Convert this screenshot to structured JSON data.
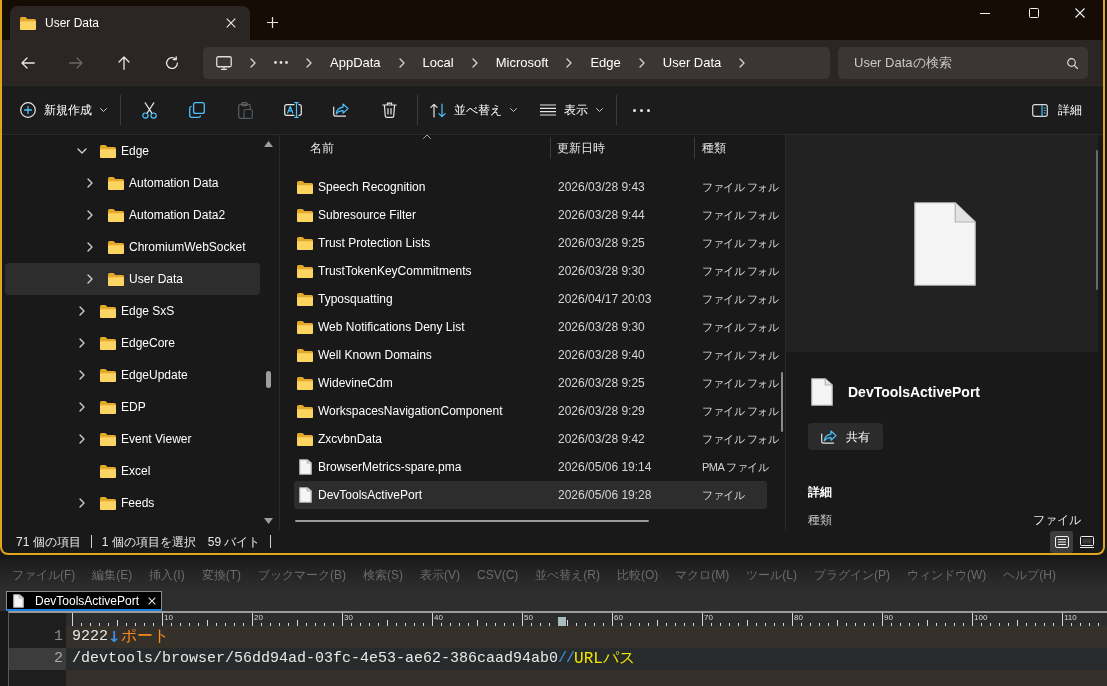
{
  "window": {
    "tabs": [
      {
        "title": "User Data",
        "selected": true
      }
    ]
  },
  "navigation": {
    "buttons": [
      {
        "kind": "back",
        "disabled": false
      },
      {
        "kind": "forward",
        "disabled": true
      },
      {
        "kind": "up",
        "disabled": false
      },
      {
        "kind": "refresh",
        "disabled": false
      }
    ],
    "breadcrumb": [
      "AppData",
      "Local",
      "Microsoft",
      "Edge",
      "User Data"
    ],
    "search": {
      "placeholder": "User Dataの検索"
    }
  },
  "toolbar": {
    "items": [
      {
        "kind": "new",
        "label": "新規作成",
        "disabled": false
      },
      {
        "kind": "separator"
      },
      {
        "kind": "cut",
        "disabled": false
      },
      {
        "kind": "copy",
        "disabled": false
      },
      {
        "kind": "paste",
        "disabled": true
      },
      {
        "kind": "rename",
        "disabled": false
      },
      {
        "kind": "share",
        "disabled": false
      },
      {
        "kind": "delete",
        "disabled": false
      },
      {
        "kind": "separator"
      },
      {
        "kind": "sort",
        "label": "並べ替え",
        "disabled": false
      },
      {
        "kind": "view",
        "label": "表示",
        "disabled": false
      },
      {
        "kind": "separator"
      },
      {
        "kind": "more",
        "disabled": false
      }
    ],
    "details_button": {
      "label": "詳細"
    }
  },
  "nav_tree": [
    {
      "label": "Edge",
      "expanded": true,
      "selected": false,
      "children": [
        {
          "label": "Automation Data",
          "expanded": false,
          "selected": false
        },
        {
          "label": "Automation Data2",
          "expanded": false,
          "selected": false
        },
        {
          "label": "ChromiumWebSocket",
          "expanded": false,
          "selected": false
        },
        {
          "label": "User Data",
          "expanded": false,
          "selected": true
        }
      ]
    },
    {
      "label": "Edge SxS",
      "expanded": false,
      "selected": false
    },
    {
      "label": "EdgeCore",
      "expanded": false,
      "selected": false
    },
    {
      "label": "EdgeUpdate",
      "expanded": false,
      "selected": false
    },
    {
      "label": "EDP",
      "expanded": false,
      "selected": false
    },
    {
      "label": "Event Viewer",
      "expanded": false,
      "selected": false
    },
    {
      "label": "Excel",
      "selected": false
    },
    {
      "label": "Feeds",
      "expanded": false,
      "selected": false
    }
  ],
  "file_list": {
    "columns": [
      {
        "label": "名前",
        "sorted": true
      },
      {
        "label": "更新日時",
        "sorted": false
      },
      {
        "label": "種類",
        "sorted": false
      }
    ],
    "rows": [
      {
        "kind": "folder",
        "name": "Speech Recognition",
        "modified": "2026/03/28 9:43",
        "type": "ファイル フォル",
        "selected": false
      },
      {
        "kind": "folder",
        "name": "Subresource Filter",
        "modified": "2026/03/28 9:44",
        "type": "ファイル フォル",
        "selected": false
      },
      {
        "kind": "folder",
        "name": "Trust Protection Lists",
        "modified": "2026/03/28 9:25",
        "type": "ファイル フォル",
        "selected": false
      },
      {
        "kind": "folder",
        "name": "TrustTokenKeyCommitments",
        "modified": "2026/03/28 9:30",
        "type": "ファイル フォル",
        "selected": false
      },
      {
        "kind": "folder",
        "name": "Typosquatting",
        "modified": "2026/04/17 20:03",
        "type": "ファイル フォル",
        "selected": false
      },
      {
        "kind": "folder",
        "name": "Web Notifications Deny List",
        "modified": "2026/03/28 9:30",
        "type": "ファイル フォル",
        "selected": false
      },
      {
        "kind": "folder",
        "name": "Well Known Domains",
        "modified": "2026/03/28 9:40",
        "type": "ファイル フォル",
        "selected": false
      },
      {
        "kind": "folder",
        "name": "WidevineCdm",
        "modified": "2026/03/28 9:25",
        "type": "ファイル フォル",
        "selected": false
      },
      {
        "kind": "folder",
        "name": "WorkspacesNavigationComponent",
        "modified": "2026/03/28 9:29",
        "type": "ファイル フォル",
        "selected": false
      },
      {
        "kind": "folder",
        "name": "ZxcvbnData",
        "modified": "2026/03/28 9:42",
        "type": "ファイル フォル",
        "selected": false
      },
      {
        "kind": "file",
        "name": "BrowserMetrics-spare.pma",
        "modified": "2026/05/06 19:14",
        "type": "PMA ファイル",
        "selected": false
      },
      {
        "kind": "file",
        "name": "DevToolsActivePort",
        "modified": "2026/05/06 19:28",
        "type": "ファイル",
        "selected": true
      }
    ]
  },
  "details_pane": {
    "title": "DevToolsActivePort",
    "share_label": "共有",
    "section_title": "詳細",
    "properties": [
      {
        "label": "種類",
        "value": "ファイル"
      }
    ]
  },
  "status_bar": {
    "item_count": "71 個の項目",
    "selection": "1 個の項目を選択",
    "size": "59 バイト",
    "views": [
      {
        "kind": "details",
        "selected": true
      },
      {
        "kind": "preview",
        "selected": false
      }
    ]
  },
  "editor": {
    "menu": [
      "ファイル(F)",
      "編集(E)",
      "挿入(I)",
      "変換(T)",
      "ブックマーク(B)",
      "検索(S)",
      "表示(V)",
      "CSV(C)",
      "並べ替え(R)",
      "比較(O)",
      "マクロ(M)",
      "ツール(L)",
      "プラグイン(P)",
      "ウィンドウ(W)",
      "ヘルプ(H)"
    ],
    "tabs": [
      {
        "title": "DevToolsActivePort",
        "selected": true
      }
    ],
    "ruler": {
      "labels": [
        "10",
        "20",
        "30",
        "40",
        "50",
        "60",
        "70",
        "80",
        "90",
        "100",
        "110"
      ]
    },
    "lines": [
      {
        "number": "1",
        "current": false,
        "segments": [
          {
            "kind": "code",
            "text": "9222",
            "color": "#e8e8e8"
          },
          {
            "kind": "newline-mark",
            "text": "↓",
            "color": "#3f8fe8"
          },
          {
            "kind": "comment",
            "text": "ポート",
            "color": "#ff8c1a"
          }
        ]
      },
      {
        "number": "2",
        "current": true,
        "segments": [
          {
            "kind": "code",
            "text": "/devtools/browser/56dd94ad-03fc-4e53-ae62-386caad94ab0",
            "color": "#e8e8e8"
          },
          {
            "kind": "comment-marker",
            "text": "//",
            "color": "#3f8fe8"
          },
          {
            "kind": "comment",
            "text": "URLパス",
            "color": "#f2e600"
          }
        ]
      }
    ]
  }
}
